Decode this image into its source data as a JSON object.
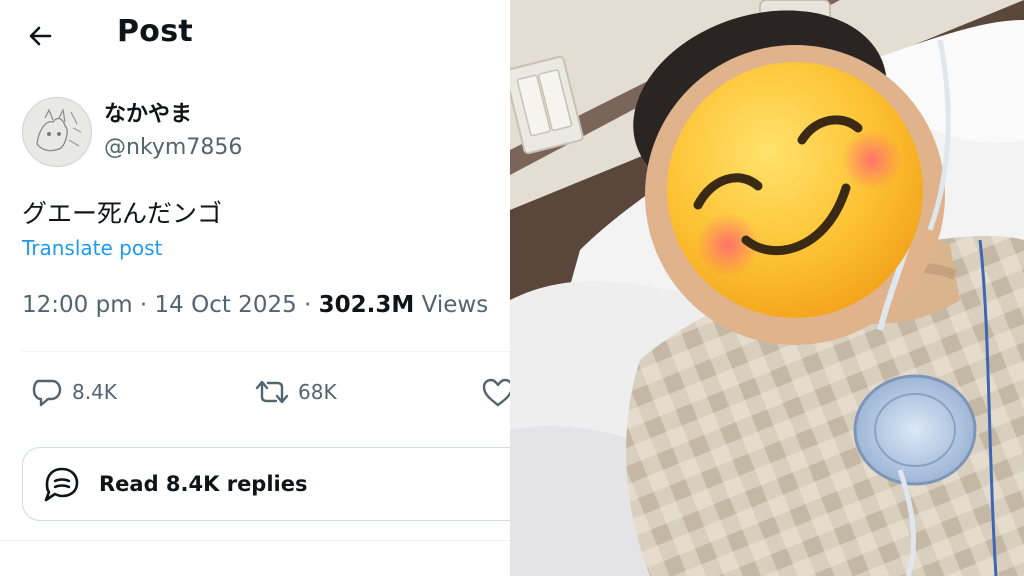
{
  "header": {
    "title": "Post"
  },
  "author": {
    "name": "なかやま",
    "handle": "@nkym7856"
  },
  "post": {
    "text": "グエー死んだンゴ",
    "translate_label": "Translate post",
    "timestamp": "12:00 pm · 14 Oct 2025 · ",
    "views_count": "302.3M",
    "views_label": " Views"
  },
  "actions": {
    "replies": "8.4K",
    "reposts": "68K"
  },
  "read_replies": {
    "label": "Read 8.4K replies"
  },
  "icons": [
    "back-arrow-icon",
    "reply-icon",
    "repost-icon",
    "like-icon",
    "replies-bubble-icon",
    "smiling-face-emoji"
  ],
  "colors": {
    "accent": "#1d9bf0",
    "secondary_text": "#536471",
    "border": "#cfd9de"
  }
}
